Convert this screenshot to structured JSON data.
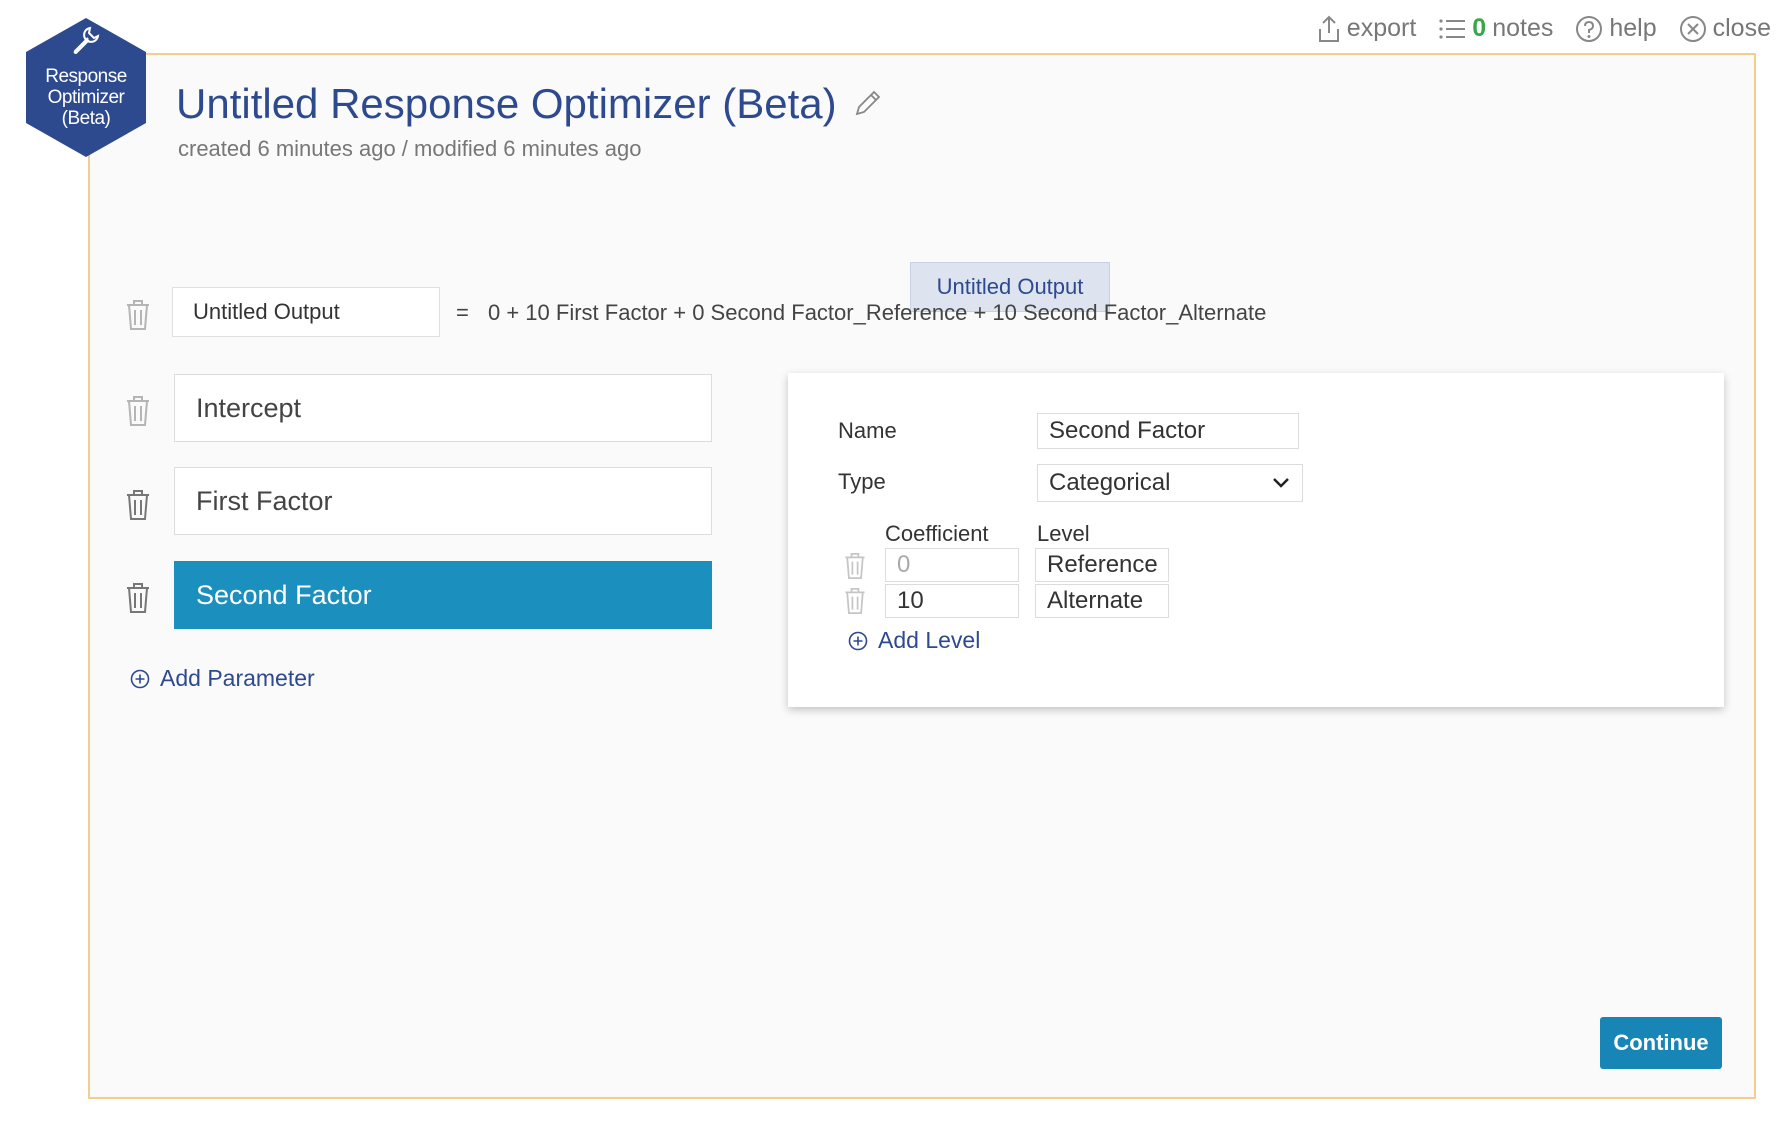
{
  "toolbar": {
    "export_label": "export",
    "notes_count": "0",
    "notes_label": "notes",
    "help_label": "help",
    "close_label": "close"
  },
  "badge": {
    "line1": "Response",
    "line2": "Optimizer",
    "line3": "(Beta)",
    "color": "#2d4a8f"
  },
  "header": {
    "title": "Untitled Response Optimizer (Beta)",
    "subtitle": "created 6 minutes ago / modified 6 minutes ago"
  },
  "output_tab": "Untitled Output",
  "equation_row": {
    "output_name": "Untitled Output",
    "equals": "=",
    "equation": "0 + 10 First Factor + 0 Second Factor_Reference + 10 Second Factor_Alternate"
  },
  "parameters": [
    {
      "label": "Intercept",
      "selected": false
    },
    {
      "label": "First Factor",
      "selected": false
    },
    {
      "label": "Second Factor",
      "selected": true
    }
  ],
  "add_parameter_label": "Add Parameter",
  "detail": {
    "name_label": "Name",
    "name_value": "Second Factor",
    "type_label": "Type",
    "type_value": "Categorical",
    "coefficient_header": "Coefficient",
    "level_header": "Level",
    "levels": [
      {
        "coefficient": "0",
        "level": "Reference"
      },
      {
        "coefficient": "10",
        "level": "Alternate"
      }
    ],
    "add_level_label": "Add Level"
  },
  "continue_label": "Continue",
  "colors": {
    "accent": "#2d4a8f",
    "selected": "#1b8fbd",
    "frame_border": "#f2cf8f",
    "continue": "#1785b5",
    "notes_count": "#3aa64a"
  }
}
